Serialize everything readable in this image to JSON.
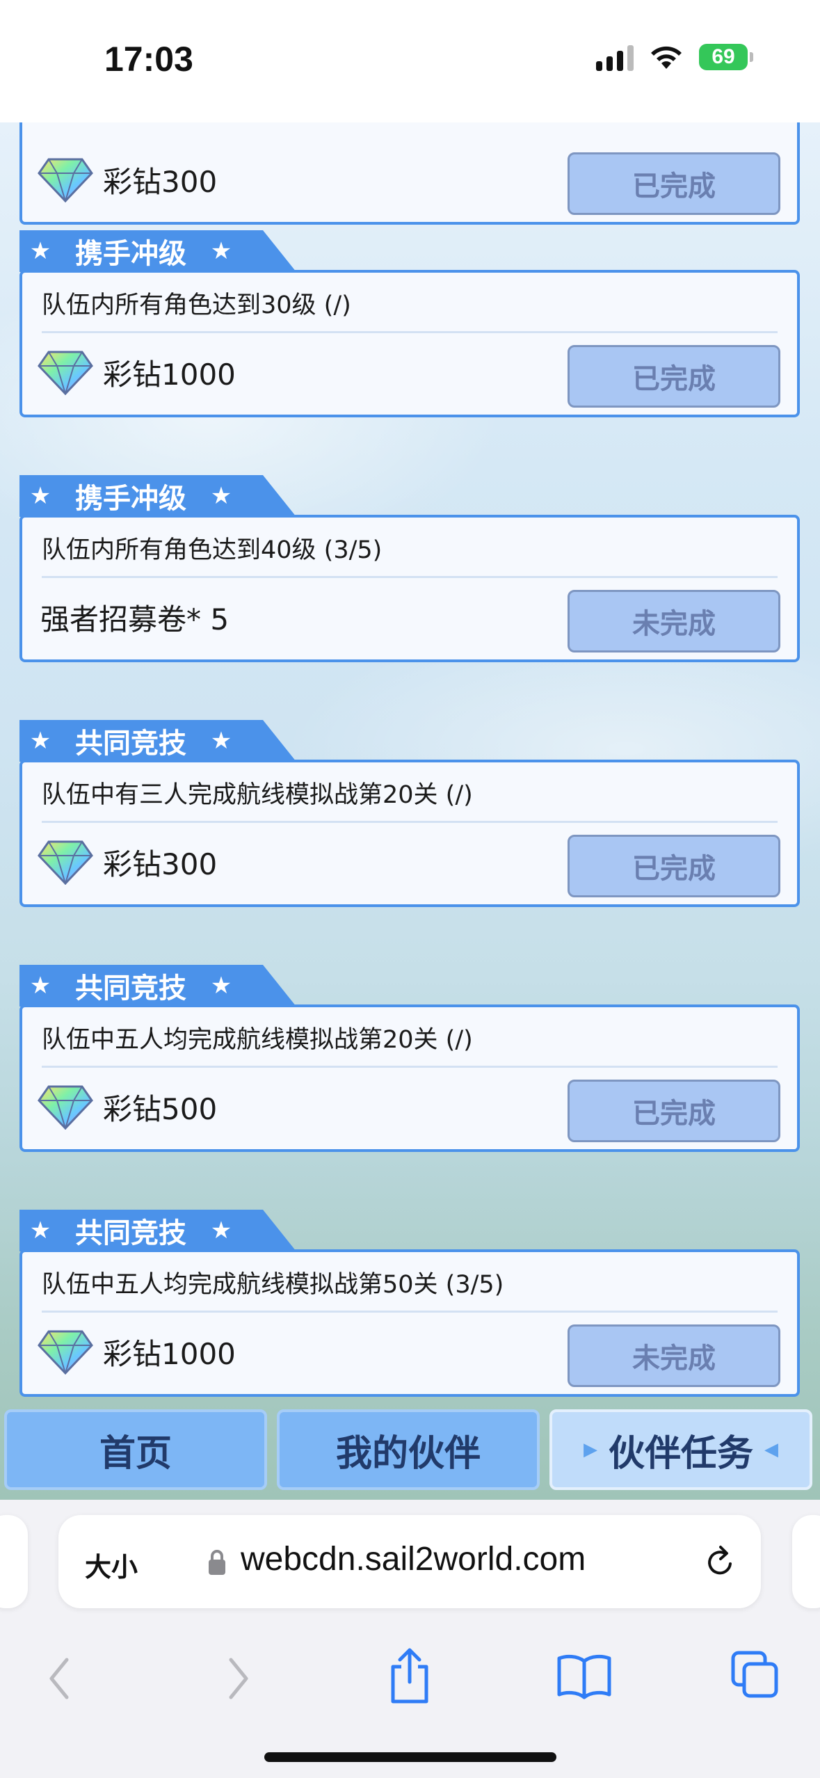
{
  "status_bar": {
    "time": "17:03",
    "battery": "69"
  },
  "tasks": [
    {
      "category": "",
      "desc": "",
      "reward": "彩钻300",
      "has_gem": true,
      "status": "已完成"
    },
    {
      "category": "携手冲级",
      "desc": "队伍内所有角色达到30级 (/)",
      "reward": "彩钻1000",
      "has_gem": true,
      "status": "已完成"
    },
    {
      "category": "携手冲级",
      "desc": "队伍内所有角色达到40级 (3/5)",
      "reward": "强者招募卷* 5",
      "has_gem": false,
      "status": "未完成"
    },
    {
      "category": "共同竞技",
      "desc": "队伍中有三人完成航线模拟战第20关 (/)",
      "reward": "彩钻300",
      "has_gem": true,
      "status": "已完成"
    },
    {
      "category": "共同竞技",
      "desc": "队伍中五人均完成航线模拟战第20关 (/)",
      "reward": "彩钻500",
      "has_gem": true,
      "status": "已完成"
    },
    {
      "category": "共同竞技",
      "desc": "队伍中五人均完成航线模拟战第50关 (3/5)",
      "reward": "彩钻1000",
      "has_gem": true,
      "status": "未完成"
    }
  ],
  "nav": {
    "home": "首页",
    "partners": "我的伙伴",
    "partner_tasks": "伙伴任务"
  },
  "safari": {
    "text_size": "大小",
    "url": "webcdn.sail2world.com"
  },
  "colors": {
    "accent": "#4b92ea",
    "button_bg": "#a9c6f3",
    "battery": "#34c759"
  },
  "icons": [
    "star-icon",
    "diamond-icon",
    "lock-icon",
    "reload-icon",
    "back-icon",
    "forward-icon",
    "share-icon",
    "bookmarks-icon",
    "tabs-icon"
  ]
}
